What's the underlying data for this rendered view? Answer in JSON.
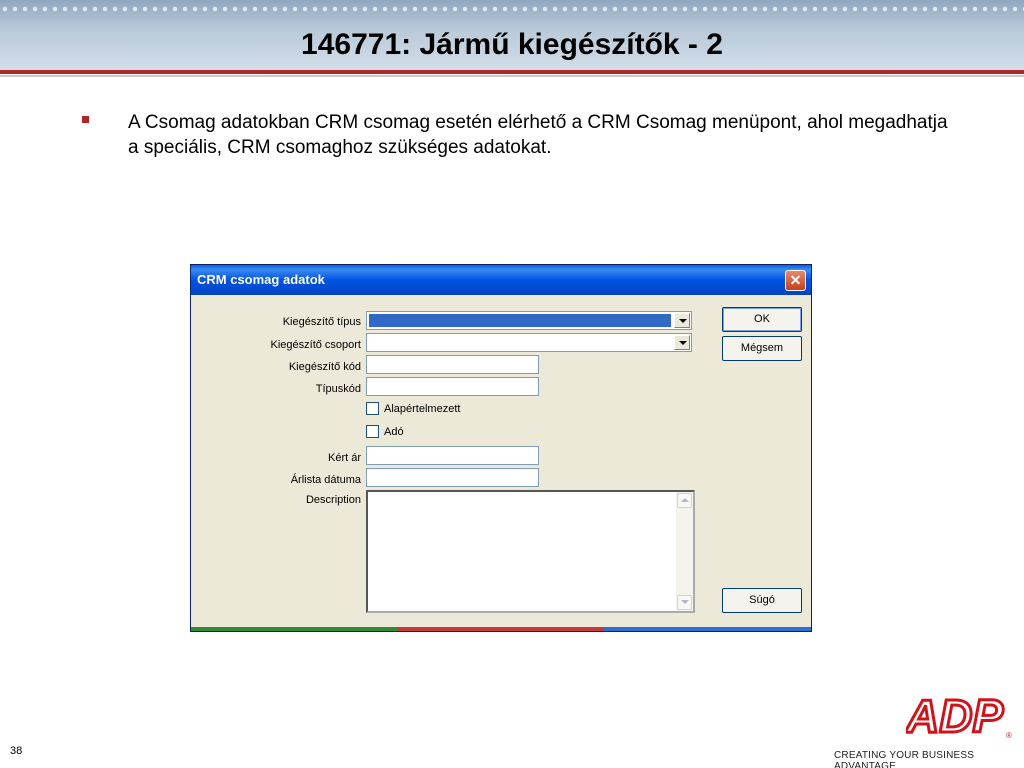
{
  "slide": {
    "title": "146771: Jármű kiegészítők - 2",
    "bullet_text": "A Csomag adatokban CRM csomag esetén elérhető a CRM Csomag menüpont, ahol megadhatja a speciális, CRM csomaghoz szükséges adatokat.",
    "page_number": "38",
    "logo_text": "ADP",
    "tagline": "CREATING YOUR BUSINESS ADVANTAGE"
  },
  "dialog": {
    "title": "CRM csomag adatok",
    "close_label": "✕",
    "fields": {
      "kiegeszito_tipus": {
        "label": "Kiegészítő típus",
        "value": ""
      },
      "kiegeszito_csoport": {
        "label": "Kiegészítő csoport",
        "value": ""
      },
      "kiegeszito_kod": {
        "label": "Kiegészítő kód",
        "value": ""
      },
      "tipuskod": {
        "label": "Típuskód",
        "value": ""
      },
      "kert_ar": {
        "label": "Kért ár",
        "value": ""
      },
      "arlista_datuma": {
        "label": "Árlista dátuma",
        "value": ""
      },
      "description": {
        "label": "Description",
        "value": ""
      }
    },
    "checkboxes": {
      "alapertelmezett": {
        "label": "Alapértelmezett",
        "checked": false
      },
      "ado": {
        "label": "Adó",
        "checked": false
      }
    },
    "buttons": {
      "ok": "OK",
      "megsem": "Mégsem",
      "sugo": "Súgó"
    },
    "colors": {
      "titlebar": "#0054e3",
      "body": "#ece9d8",
      "selection": "#316ac5",
      "strip": [
        "#2f8b3a",
        "#c23a3a",
        "#2f6fcf"
      ]
    }
  }
}
